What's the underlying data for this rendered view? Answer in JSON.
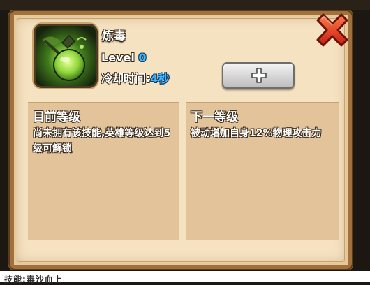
{
  "skill": {
    "name": "炼毒",
    "level_label": "Level",
    "level_value": "0",
    "cooldown_label": "冷却时间:",
    "cooldown_value": "4秒",
    "icon": "poison-flask-icon"
  },
  "buttons": {
    "upgrade_icon": "plus-icon",
    "close_icon": "close-x-icon"
  },
  "current_level": {
    "title": "目前等级",
    "description": "尚未拥有该技能,英雄等级达到5级可解锁"
  },
  "next_level": {
    "title": "下一等级",
    "description": "被动增加自身12%物理攻击力"
  },
  "footer": {
    "text": "技能:毒沙血上"
  },
  "colors": {
    "accent_blue": "#3fb4ff",
    "parchment": "#f5e2c0",
    "close_red": "#e23c1e"
  }
}
